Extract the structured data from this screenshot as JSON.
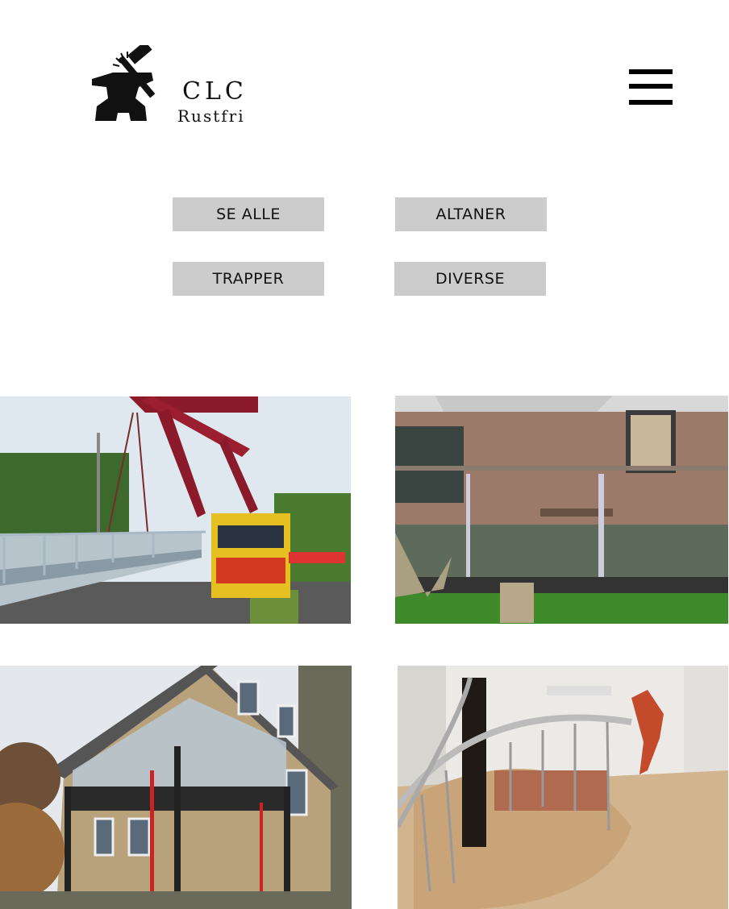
{
  "header": {
    "logo_main": "CLC",
    "logo_sub": "Rustfri",
    "logo_icon": "anvil-hammer-icon",
    "menu_icon": "hamburger-menu-icon"
  },
  "filters": {
    "all_label": "SE ALLE",
    "balconies_label": "ALTANER",
    "stairs_label": "TRAPPER",
    "misc_label": "DIVERSE"
  },
  "gallery": {
    "photo_1": "crane-truck-photo",
    "photo_2": "glass-railing-photo",
    "photo_3": "balcony-house-photo",
    "photo_4": "spiral-stair-photo"
  },
  "colors": {
    "button_bg": "#cccccc",
    "text": "#111111"
  }
}
